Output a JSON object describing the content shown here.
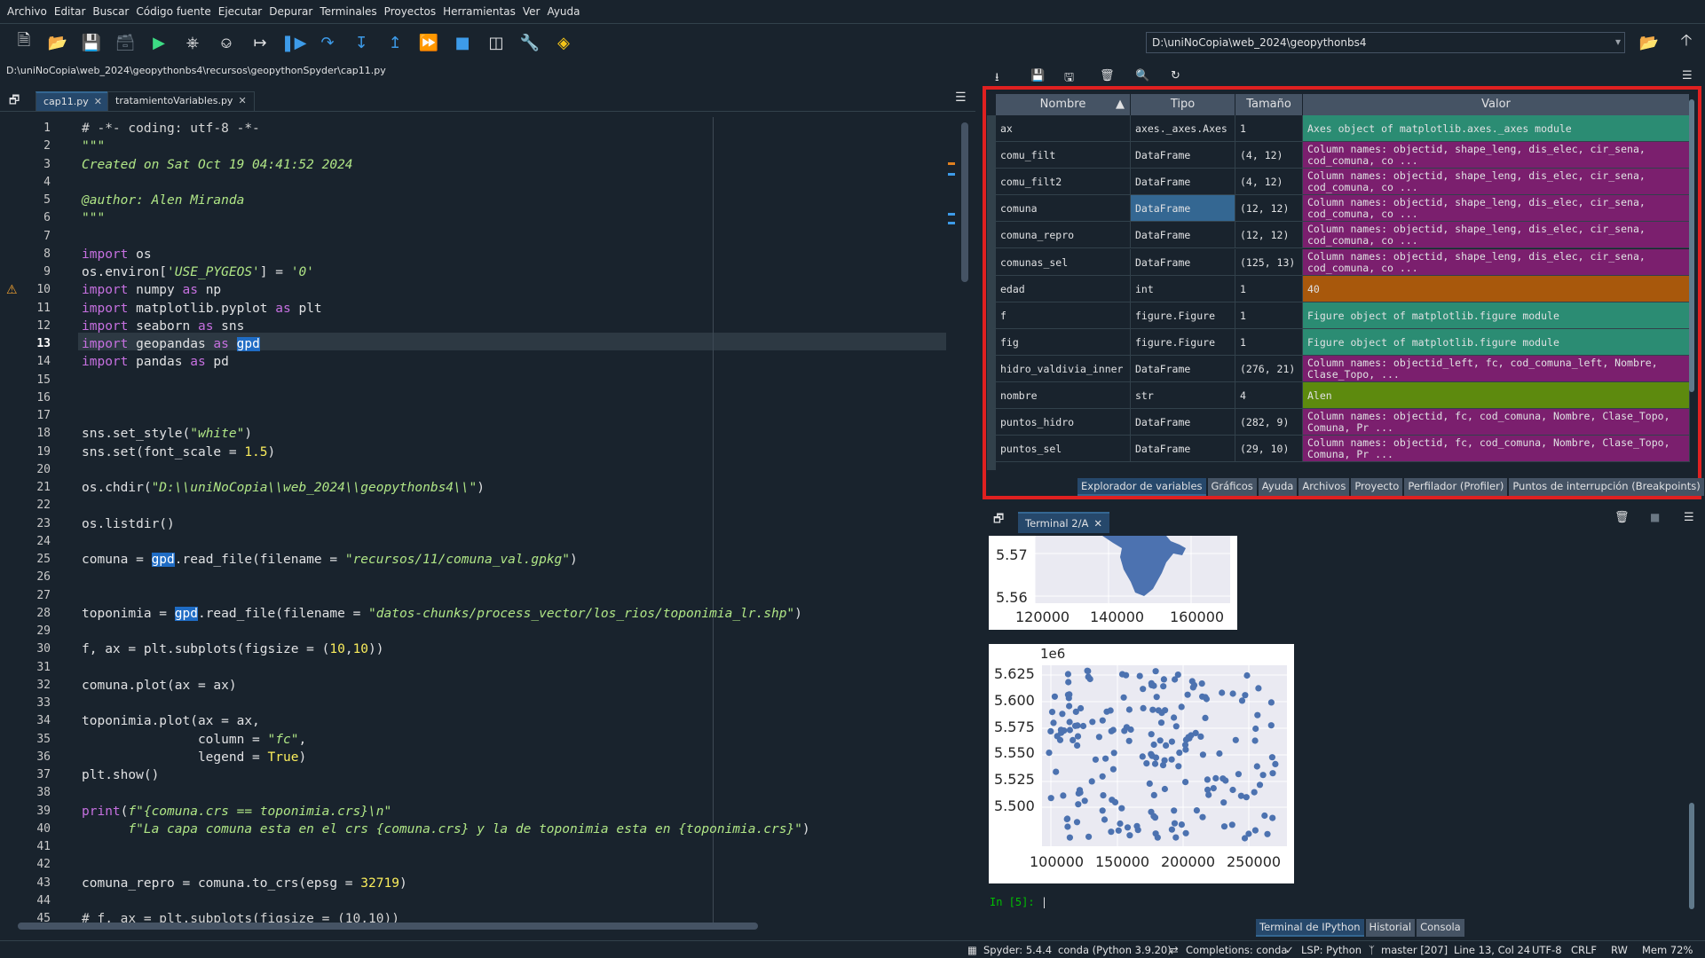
{
  "menu": [
    "Archivo",
    "Editar",
    "Buscar",
    "Código fuente",
    "Ejecutar",
    "Depurar",
    "Terminales",
    "Proyectos",
    "Herramientas",
    "Ver",
    "Ayuda"
  ],
  "toolbar": {
    "working_dir": "D:\\uniNoCopia\\web_2024\\geopythonbs4"
  },
  "editor": {
    "file_path": "D:\\uniNoCopia\\web_2024\\geopythonbs4\\recursos\\geopythonSpyder\\cap11.py",
    "tabs": [
      {
        "label": "cap11.py",
        "active": true
      },
      {
        "label": "tratamientoVariables.py",
        "active": false
      }
    ],
    "current_line": 13,
    "warning_line": 10
  },
  "variable_explorer": {
    "columns": [
      "Nombre",
      "Tipo",
      "Tamaño",
      "Valor"
    ],
    "rows": [
      {
        "name": "ax",
        "type": "axes._axes.Axes",
        "size": "1",
        "value": "Axes object of matplotlib.axes._axes module",
        "color": "#2b8c73"
      },
      {
        "name": "comu_filt",
        "type": "DataFrame",
        "size": "(4, 12)",
        "value": "Column names: objectid, shape_leng, dis_elec, cir_sena, cod_comuna, co ...",
        "color": "#7b1f6e"
      },
      {
        "name": "comu_filt2",
        "type": "DataFrame",
        "size": "(4, 12)",
        "value": "Column names: objectid, shape_leng, dis_elec, cir_sena, cod_comuna, co ...",
        "color": "#7b1f6e"
      },
      {
        "name": "comuna",
        "type": "DataFrame",
        "size": "(12, 12)",
        "value": "Column names: objectid, shape_leng, dis_elec, cir_sena, cod_comuna, co ...",
        "color": "#7b1f6e",
        "selected": true
      },
      {
        "name": "comuna_repro",
        "type": "DataFrame",
        "size": "(12, 12)",
        "value": "Column names: objectid, shape_leng, dis_elec, cir_sena, cod_comuna, co ...",
        "color": "#7b1f6e"
      },
      {
        "name": "comunas_sel",
        "type": "DataFrame",
        "size": "(125, 13)",
        "value": "Column names: objectid, shape_leng, dis_elec, cir_sena, cod_comuna, co ...",
        "color": "#7b1f6e"
      },
      {
        "name": "edad",
        "type": "int",
        "size": "1",
        "value": "40",
        "color": "#a8580c"
      },
      {
        "name": "f",
        "type": "figure.Figure",
        "size": "1",
        "value": "Figure object of matplotlib.figure module",
        "color": "#2b8c73"
      },
      {
        "name": "fig",
        "type": "figure.Figure",
        "size": "1",
        "value": "Figure object of matplotlib.figure module",
        "color": "#2b8c73"
      },
      {
        "name": "hidro_valdivia_inner",
        "type": "DataFrame",
        "size": "(276, 21)",
        "value": "Column names: objectid_left, fc, cod_comuna_left, Nombre, Clase_Topo, ...",
        "color": "#7b1f6e"
      },
      {
        "name": "nombre",
        "type": "str",
        "size": "4",
        "value": "Alen",
        "color": "#5d8a0e"
      },
      {
        "name": "puntos_hidro",
        "type": "DataFrame",
        "size": "(282, 9)",
        "value": "Column names: objectid, fc, cod_comuna, Nombre, Clase_Topo, Comuna, Pr ...",
        "color": "#7b1f6e"
      },
      {
        "name": "puntos_sel",
        "type": "DataFrame",
        "size": "(29, 10)",
        "value": "Column names: objectid, fc, cod_comuna, Nombre, Clase_Topo, Comuna, Pr ...",
        "color": "#7b1f6e"
      }
    ]
  },
  "pane_tabs": [
    "Explorador de variables",
    "Gráficos",
    "Ayuda",
    "Archivos",
    "Proyecto",
    "Perfilador (Profiler)",
    "Puntos de interrupción (Breakpoints)"
  ],
  "console": {
    "tab_label": "Terminal 2/A",
    "prompt": "In [5]:",
    "plot1": {
      "yticks": [
        "5.57",
        "5.56"
      ],
      "xticks": [
        "120000",
        "140000",
        "160000"
      ]
    },
    "plot2": {
      "exponent": "1e6",
      "yticks": [
        "5.625",
        "5.600",
        "5.575",
        "5.550",
        "5.525",
        "5.500"
      ],
      "xticks": [
        "100000",
        "150000",
        "200000",
        "250000"
      ]
    }
  },
  "console_tabs": [
    "Terminal de IPython",
    "Historial",
    "Consola"
  ],
  "status": {
    "spyder": "Spyder: 5.4.4",
    "conda": "conda (Python 3.9.20)",
    "completions": "Completions: conda",
    "lsp": "LSP: Python",
    "git": "master [207]",
    "position": "Line 13, Col 24",
    "encoding": "UTF-8",
    "eol": "CRLF",
    "rw": "RW",
    "mem": "Mem 72%"
  }
}
